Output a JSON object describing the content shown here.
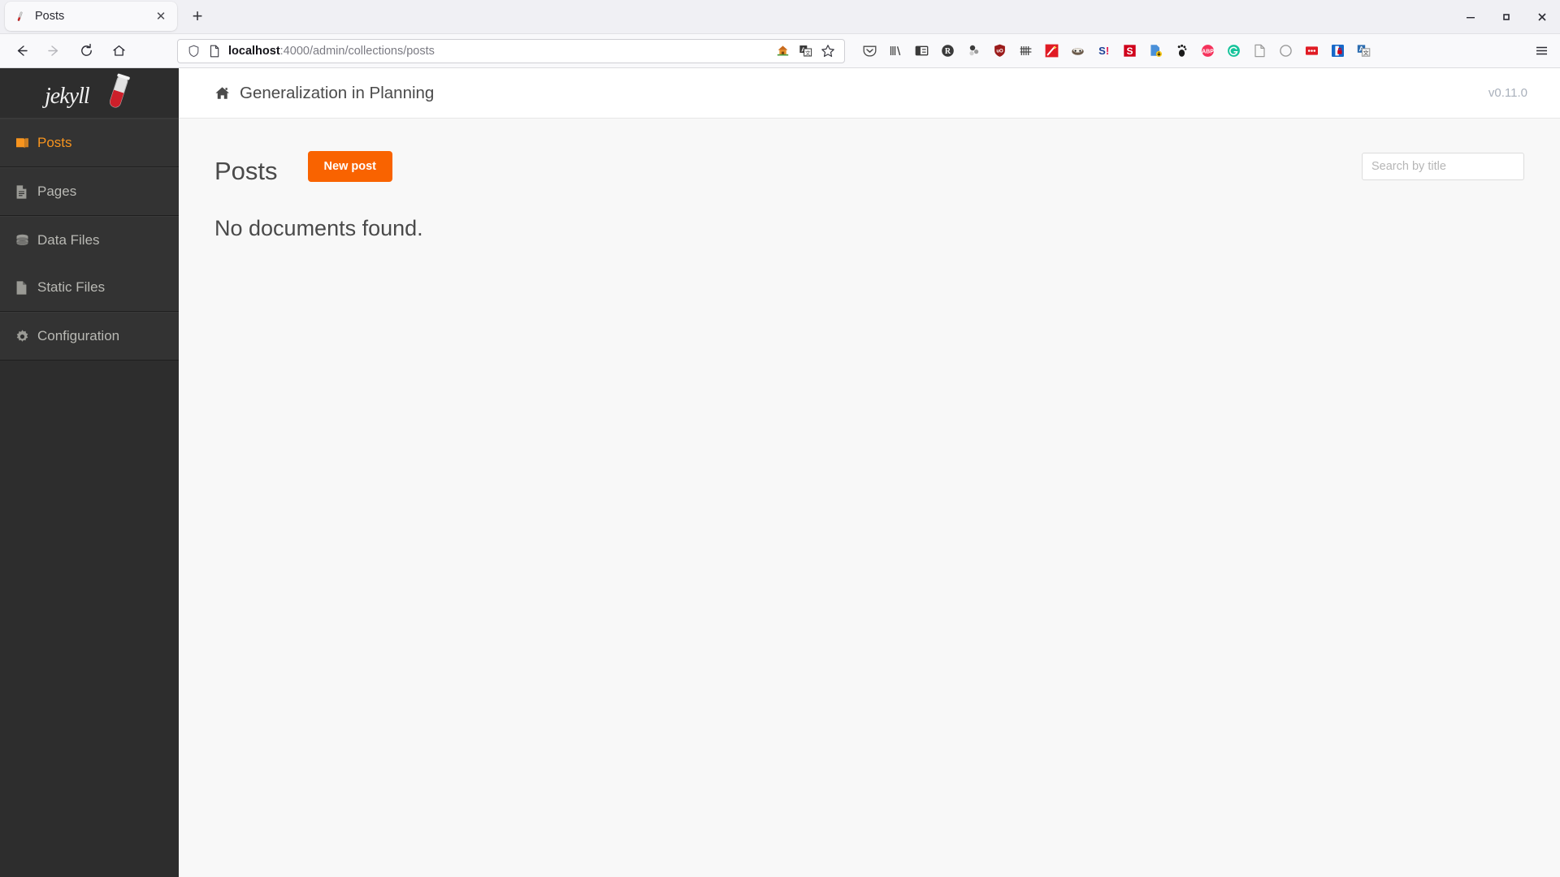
{
  "browser": {
    "tab": {
      "title": "Posts",
      "favicon_name": "jekyll-favicon",
      "close_glyph": "✕"
    },
    "new_tab_glyph": "+",
    "window_controls": [
      {
        "name": "minimize",
        "glyph": "—"
      },
      {
        "name": "maximize",
        "glyph": "□"
      },
      {
        "name": "close",
        "glyph": "✕"
      }
    ],
    "nav_buttons": [
      {
        "name": "back-button",
        "glyph": "←",
        "enabled": true
      },
      {
        "name": "forward-button",
        "glyph": "→",
        "enabled": false
      },
      {
        "name": "reload-button",
        "glyph": "↻",
        "enabled": true
      },
      {
        "name": "home-button",
        "glyph": "⌂",
        "enabled": true
      }
    ],
    "url": {
      "host": "localhost",
      "path": ":4000/admin/collections/posts",
      "full": "localhost:4000/admin/collections/posts",
      "shield_icon": "tracking-protection-shield-icon",
      "page_icon": "page-document-icon",
      "actions": [
        {
          "name": "home-page-action-icon"
        },
        {
          "name": "translate-page-icon"
        },
        {
          "name": "bookmark-star-icon"
        }
      ]
    },
    "extensions": [
      {
        "name": "pocket-extension-icon",
        "color": "#4a4a4a"
      },
      {
        "name": "library-extension-icon",
        "color": "#3a3a3a"
      },
      {
        "name": "reader-sidebar-extension-icon",
        "color": "#3a3a3a"
      },
      {
        "name": "reddit-extension-icon",
        "color": "#3a3a3a"
      },
      {
        "name": "molecule-extension-icon",
        "color": "#555555"
      },
      {
        "name": "ublock-origin-extension-icon",
        "color": "#9b1b1b"
      },
      {
        "name": "fence-extension-icon",
        "color": "#4a4a4a"
      },
      {
        "name": "magic-wand-extension-icon",
        "color": "#e01b24"
      },
      {
        "name": "honey-badger-extension-icon",
        "color": "#6b5a4a"
      },
      {
        "name": "skyscanner-extension-icon",
        "color": "#1c3f94"
      },
      {
        "name": "sesame-extension-icon",
        "color": "#d0021b"
      },
      {
        "name": "save-page-extension-icon",
        "color": "#4a90d9"
      },
      {
        "name": "gnome-extension-icon",
        "color": "#1a1a1a"
      },
      {
        "name": "adblock-plus-extension-icon",
        "color": "#f5325b"
      },
      {
        "name": "grammarly-extension-icon",
        "color": "#15c39a"
      },
      {
        "name": "document-extension-icon",
        "color": "#9a9a9a"
      },
      {
        "name": "circle-extension-icon",
        "color": "#9a9a9a"
      },
      {
        "name": "dots-extension-icon",
        "color": "#e01b24"
      },
      {
        "name": "password-shield-extension-icon",
        "color": "#1869c9"
      },
      {
        "name": "translate-extension-icon",
        "color": "#2b6cb0"
      }
    ],
    "menu_glyph": "☰"
  },
  "sidebar": {
    "logo_text": "jekyll",
    "groups": [
      {
        "items": [
          {
            "label": "Posts",
            "icon": "book-icon",
            "active": true
          }
        ]
      },
      {
        "items": [
          {
            "label": "Pages",
            "icon": "file-text-icon",
            "active": false
          }
        ]
      },
      {
        "items": [
          {
            "label": "Data Files",
            "icon": "database-icon",
            "active": false
          },
          {
            "label": "Static Files",
            "icon": "file-icon",
            "active": false
          }
        ]
      },
      {
        "items": [
          {
            "label": "Configuration",
            "icon": "gear-icon",
            "active": false
          }
        ]
      }
    ]
  },
  "header": {
    "home_icon": "home-icon",
    "site_title": "Generalization in Planning",
    "version": "v0.11.0"
  },
  "main": {
    "page_title": "Posts",
    "new_post_label": "New post",
    "search_placeholder": "Search by title",
    "search_value": "",
    "empty_message": "No documents found."
  },
  "colors": {
    "accent_orange": "#f96300",
    "sidebar_bg": "#2d2d2d",
    "sidebar_item_bg": "#333333",
    "active_text": "#f7941e",
    "page_bg": "#f8f8f8"
  }
}
